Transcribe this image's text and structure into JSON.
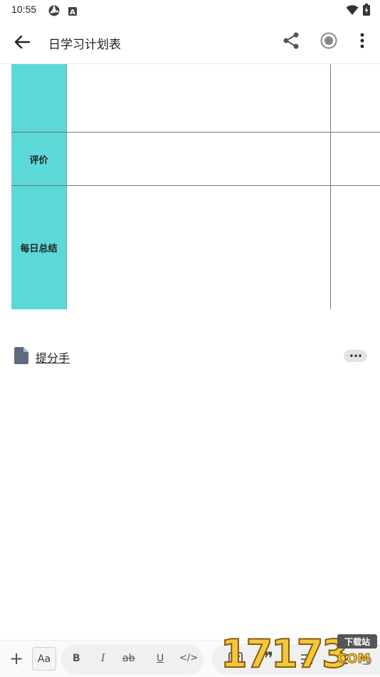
{
  "status_bar": {
    "time": "10:55"
  },
  "app_bar": {
    "title": "日学习计划表"
  },
  "table": {
    "rows": [
      {
        "label": ""
      },
      {
        "label": "评价"
      },
      {
        "label": "每日总结"
      }
    ],
    "header_color": "#5dd8d8"
  },
  "attachment": {
    "name": "提分手",
    "more_label": "•••"
  },
  "toolbar": {
    "add_label": "+",
    "text_style_label": "Aa",
    "bold_label": "B",
    "italic_label": "I",
    "strike_label": "ab",
    "underline_label": "U",
    "code_label": "</>",
    "quote_label": "❞"
  },
  "watermark": {
    "digits": "17173",
    "tag": "下载站",
    "suffix": "COM"
  }
}
